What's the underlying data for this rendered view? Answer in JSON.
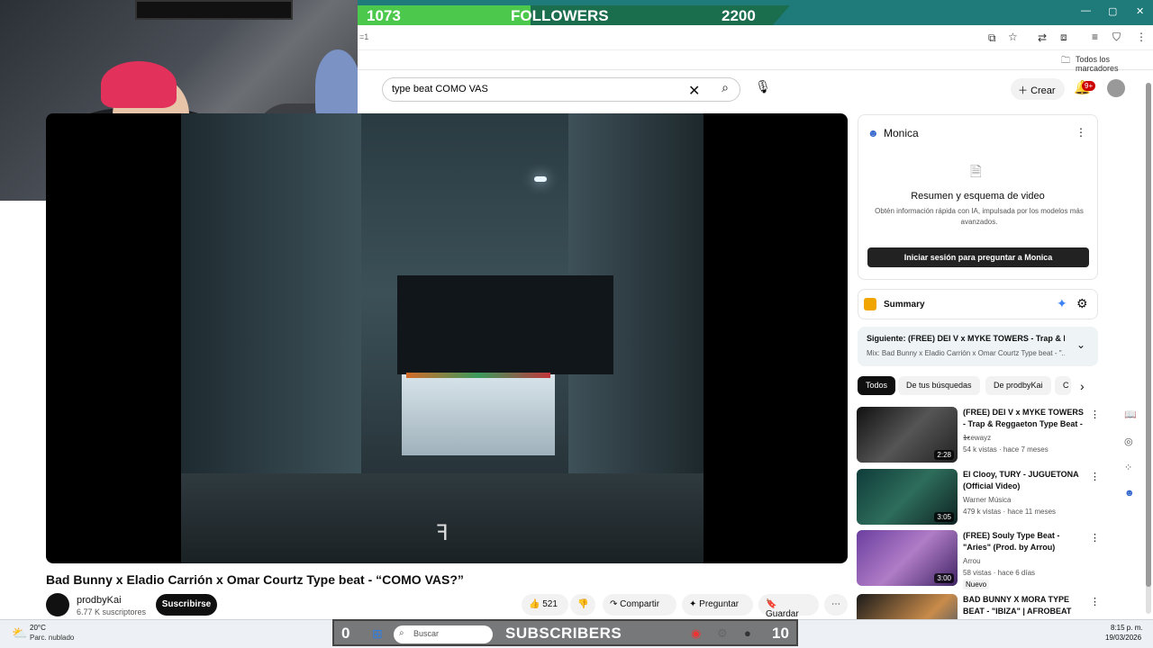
{
  "overlay": {
    "followers_current": "1073",
    "followers_label": "FOLLOWERS",
    "followers_goal": "2200",
    "subs_current": "0",
    "subs_label": "SUBSCRIBERS",
    "subs_goal": "10"
  },
  "browser": {
    "address_fragment": "=1",
    "bookmarks_label": "Todos los marcadores"
  },
  "header": {
    "search_value": "type beat COMO VAS",
    "create_label": "Crear",
    "notif_badge": "9+"
  },
  "video": {
    "title": "Bad Bunny x Eladio Carrión x Omar Courtz Type beat - “COMO VAS?”",
    "channel": "prodbyKai",
    "subscribers": "6.77 K suscriptores",
    "subscribe_label": "Suscribirse",
    "likes": "521",
    "share_label": "Compartir",
    "ask_label": "Preguntar",
    "save_label": "Guardar"
  },
  "monica": {
    "title": "Monica",
    "heading": "Resumen y esquema de video",
    "description": "Obtén información rápida con IA, impulsada por los modelos más avanzados.",
    "button": "Iniciar sesión para preguntar a Monica"
  },
  "summary": {
    "label": "Summary"
  },
  "next": {
    "label": "Siguiente: (FREE) DEI V x MYKE TOWERS - Trap & R...",
    "sub": "Mix: Bad Bunny x Eladio Carrión x Omar Courtz Type beat - \"..."
  },
  "chips": [
    "Todos",
    "De tus búsquedas",
    "De prodbyKai",
    "C"
  ],
  "recs": [
    {
      "title": "(FREE) DEI V x MYKE TOWERS - Trap & Reggaeton Type Beat - ...",
      "channel": "1cewayz",
      "meta": "54 k vistas · hace 7 meses",
      "duration": "2:28",
      "badge": ""
    },
    {
      "title": "El Clooy, TURY - JUGUETONA (Official Video)",
      "channel": "Warner Música",
      "meta": "479 k vistas · hace 11 meses",
      "duration": "3:05",
      "badge": ""
    },
    {
      "title": "(FREE) Souly Type Beat - \"Aries\" (Prod. by Arrou)",
      "channel": "Arrou",
      "meta": "58 vistas · hace 6 días",
      "duration": "3:00",
      "badge": "Nuevo"
    },
    {
      "title": "BAD BUNNY X MORA TYPE BEAT - \"IBIZA\" | AFROBEAT",
      "channel": "",
      "meta": "",
      "duration": "",
      "badge": ""
    }
  ],
  "taskbar": {
    "temp": "20°C",
    "weather": "Parc. nublado",
    "search": "Buscar",
    "time": "8:15 p. m.",
    "date": "19/03/2026"
  }
}
